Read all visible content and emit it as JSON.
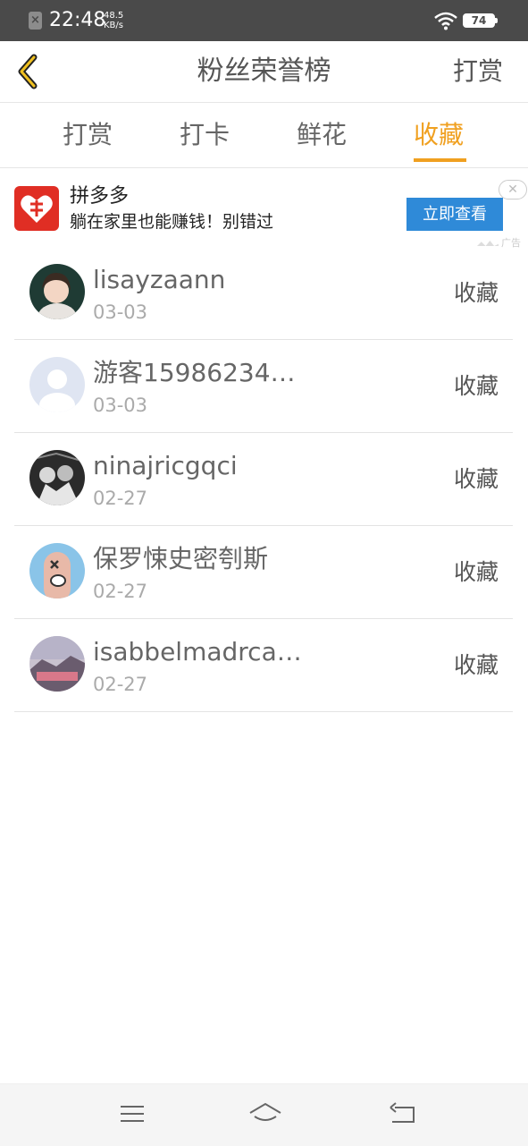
{
  "status_bar": {
    "time": "22:48",
    "speed_value": "48.5",
    "speed_unit": "KB/s",
    "battery": "74",
    "icons": [
      "notification-x-icon",
      "wifi-icon",
      "battery-icon"
    ]
  },
  "header": {
    "title": "粉丝荣誉榜",
    "action": "打赏",
    "back_icon": "chevron-left-icon",
    "accent_color": "#f0a020"
  },
  "tabs": [
    {
      "label": "打赏",
      "active": false
    },
    {
      "label": "打卡",
      "active": false
    },
    {
      "label": "鲜花",
      "active": false
    },
    {
      "label": "收藏",
      "active": true
    }
  ],
  "ad": {
    "title": "拼多多",
    "subtitle": "躺在家里也能赚钱！别错过",
    "button": "立即查看",
    "tag": "广告",
    "close_icon": "close-icon",
    "button_color": "#2f8ad8"
  },
  "list": [
    {
      "name": "lisayzaann",
      "date": "03-03",
      "action": "收藏"
    },
    {
      "name": "游客15986234…",
      "date": "03-03",
      "action": "收藏"
    },
    {
      "name": "ninajricgqci",
      "date": "02-27",
      "action": "收藏"
    },
    {
      "name": "保罗悚史密刳斯",
      "date": "02-27",
      "action": "收藏"
    },
    {
      "name": "isabbelmadrca…",
      "date": "02-27",
      "action": "收藏"
    }
  ],
  "nav": {
    "icons": [
      "menu-icon",
      "home-icon",
      "back-icon"
    ]
  }
}
